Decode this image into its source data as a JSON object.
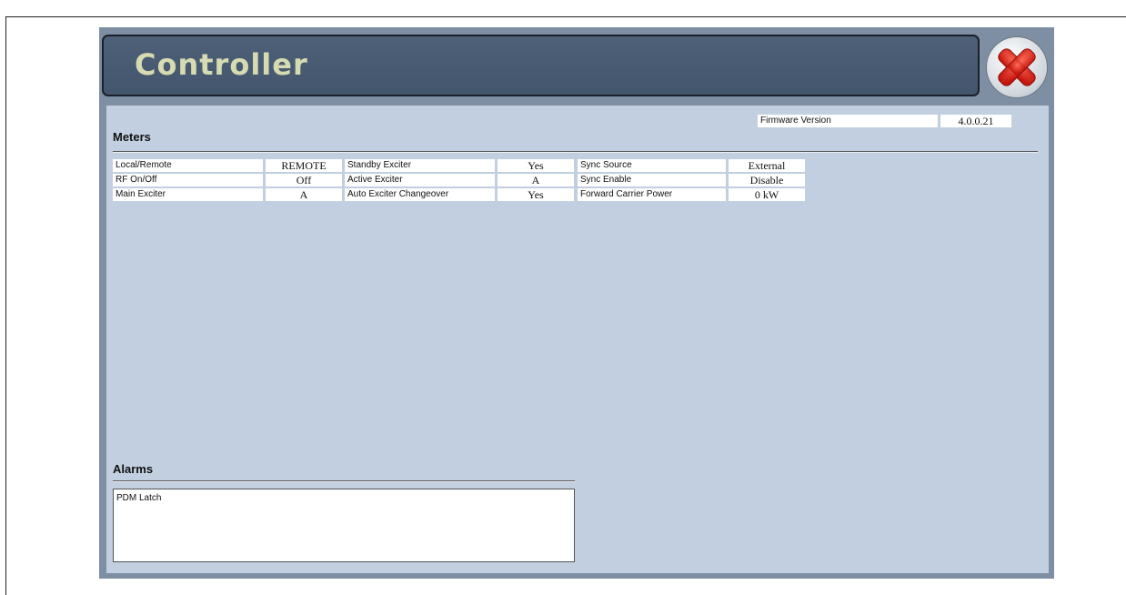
{
  "window": {
    "title": "Controller",
    "close_icon": "close-icon"
  },
  "firmware": {
    "label": "Firmware Version",
    "value": "4.0.0.21"
  },
  "meters": {
    "heading": "Meters",
    "col1": [
      {
        "label": "Local/Remote",
        "value": "REMOTE"
      },
      {
        "label": "RF On/Off",
        "value": "Off"
      },
      {
        "label": "Main Exciter",
        "value": "A"
      }
    ],
    "col2": [
      {
        "label": "Standby Exciter",
        "value": "Yes"
      },
      {
        "label": "Active Exciter",
        "value": "A"
      },
      {
        "label": "Auto Exciter Changeover",
        "value": "Yes"
      }
    ],
    "col3": [
      {
        "label": "Sync Source",
        "value": "External"
      },
      {
        "label": "Sync Enable",
        "value": "Disable"
      },
      {
        "label": "Forward Carrier Power",
        "value": "0 kW"
      }
    ]
  },
  "alarms": {
    "heading": "Alarms",
    "items": [
      "PDM Latch"
    ]
  },
  "colors": {
    "title_bar": "#4e6078",
    "title_text": "#d7dbb1",
    "panel_bg": "#c2cfe0",
    "close_red": "#e2231a"
  }
}
